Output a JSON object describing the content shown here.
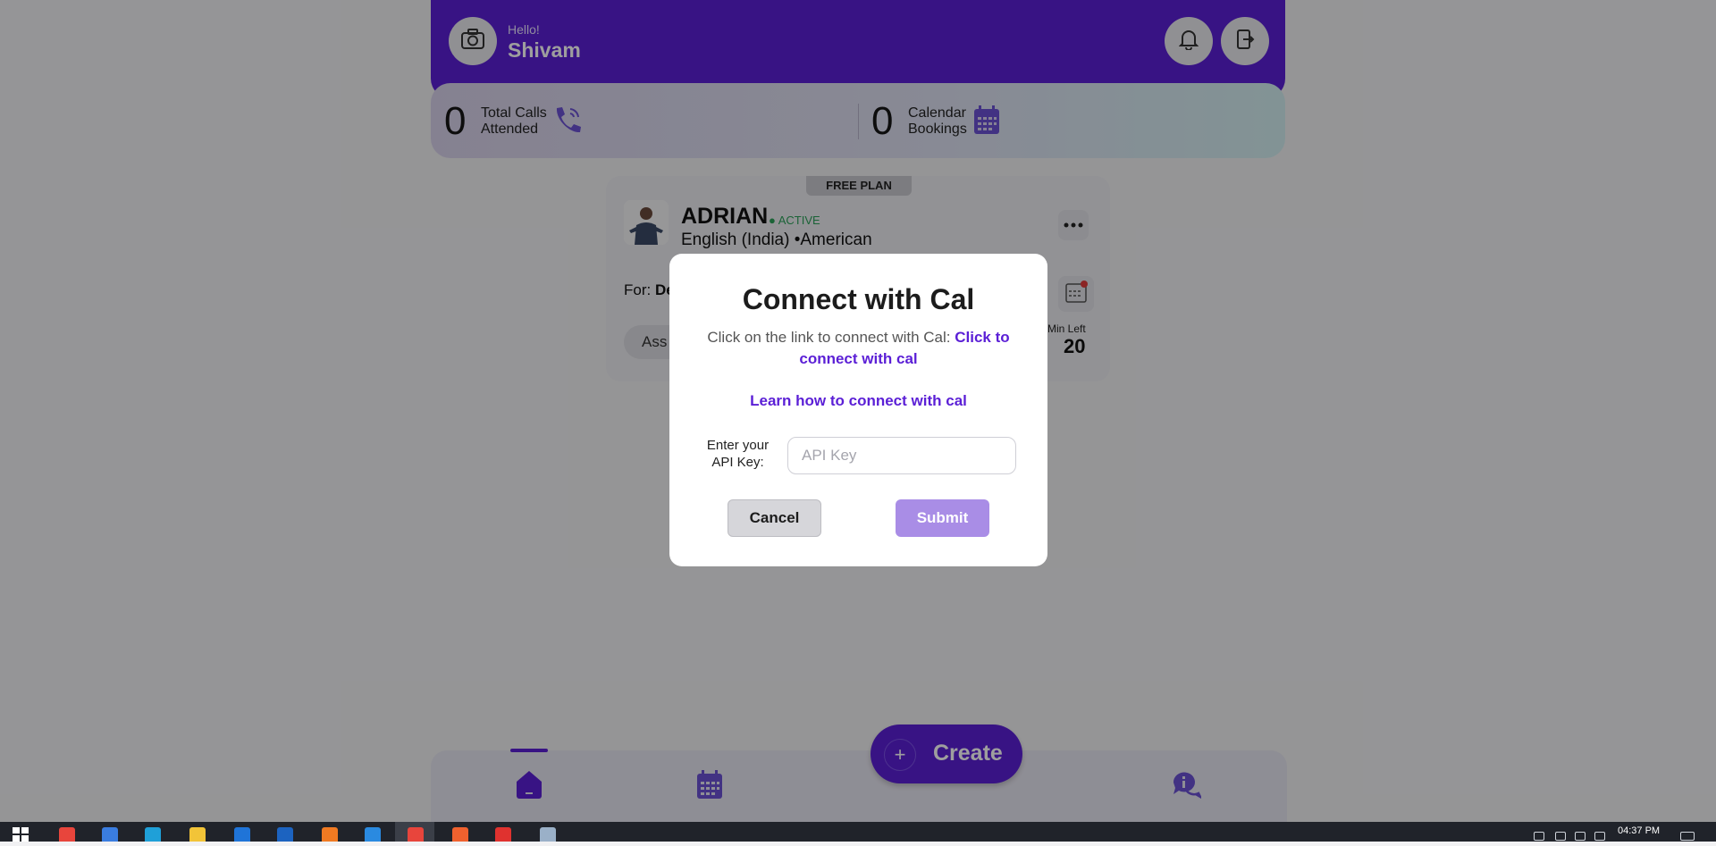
{
  "header": {
    "greeting": "Hello!",
    "username": "Shivam"
  },
  "stats": [
    {
      "value": "0",
      "label_line1": "Total Calls",
      "label_line2": "Attended",
      "icon": "phone-icon"
    },
    {
      "value": "0",
      "label_line1": "Calendar",
      "label_line2": "Bookings",
      "icon": "calendar-icon"
    }
  ],
  "agent_card": {
    "plan_badge": "FREE PLAN",
    "name": "ADRIAN",
    "status": "ACTIVE",
    "language": "English (India) •American",
    "for_label": "For: ",
    "for_value": "De",
    "assign_label": "Ass",
    "min_left_label": "Min Left",
    "min_left_value": "20"
  },
  "modal": {
    "title": "Connect with Cal",
    "description_prefix": "Click on the link to connect with Cal: ",
    "connect_link": "Click to connect with cal",
    "learn_link": "Learn how to connect with cal",
    "api_label_line1": "Enter your",
    "api_label_line2": "API Key:",
    "api_placeholder": "API Key",
    "api_value": "",
    "cancel_label": "Cancel",
    "submit_label": "Submit"
  },
  "bottom_nav": {
    "create_label": "Create",
    "create_icon": "plus-icon",
    "items": [
      "home-icon",
      "calendar-icon",
      "chat-icon"
    ]
  },
  "taskbar": {
    "time": "04:37 PM"
  },
  "colors": {
    "brand": "#5b1fd6",
    "submit_disabled": "#a98de6",
    "active_status": "#2ca05a"
  }
}
